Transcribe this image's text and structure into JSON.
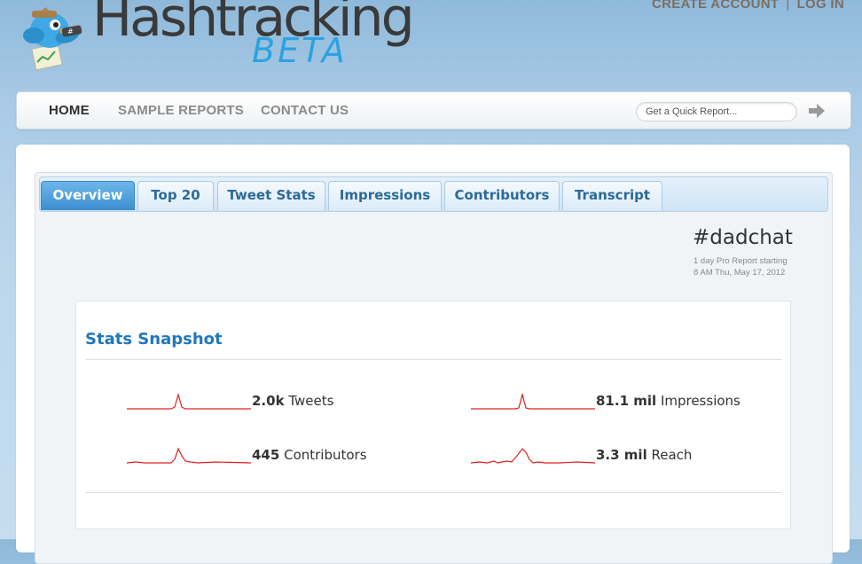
{
  "header": {
    "brand": "Hashtracking",
    "beta": "BETA",
    "account": {
      "create": "CREATE ACCOUNT",
      "separator": "|",
      "login": "LOG IN"
    }
  },
  "nav": {
    "items": [
      {
        "label": "HOME",
        "active": true
      },
      {
        "label": "SAMPLE REPORTS",
        "active": false
      },
      {
        "label": "CONTACT US",
        "active": false
      }
    ],
    "quick_report_placeholder": "Get a Quick Report...",
    "go_icon": "arrow-right-icon"
  },
  "tabs": [
    {
      "label": "Overview",
      "active": true
    },
    {
      "label": "Top 20",
      "active": false
    },
    {
      "label": "Tweet Stats",
      "active": false
    },
    {
      "label": "Impressions",
      "active": false
    },
    {
      "label": "Contributors",
      "active": false
    },
    {
      "label": "Transcript",
      "active": false
    }
  ],
  "report": {
    "hashtag": "#dadchat",
    "line1": "1 day Pro Report starting",
    "line2": "8 AM Thu, May 17, 2012"
  },
  "snapshot": {
    "title": "Stats Snapshot",
    "stats": [
      {
        "value": "2.0k",
        "label": "Tweets"
      },
      {
        "value": "81.1 mil",
        "label": "Impressions"
      },
      {
        "value": "445",
        "label": "Contributors"
      },
      {
        "value": "3.3 mil",
        "label": "Reach"
      }
    ]
  },
  "colors": {
    "accent": "#1f77c0",
    "sparkline": "#e02020",
    "tab_active": "#4a9ad8"
  }
}
